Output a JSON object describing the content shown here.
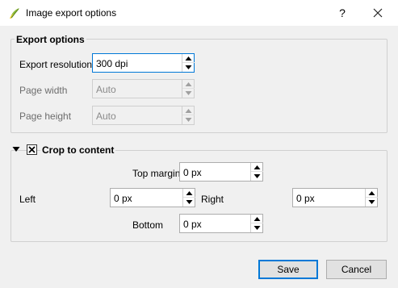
{
  "window": {
    "title": "Image export options",
    "help_label": "?",
    "app_icon": "qgis-icon",
    "close_icon": "close-icon"
  },
  "export_options": {
    "title": "Export options",
    "resolution": {
      "label": "Export resolution",
      "value": "300 dpi",
      "enabled": true
    },
    "page_width": {
      "label": "Page width",
      "value": "Auto",
      "enabled": false
    },
    "page_height": {
      "label": "Page height",
      "value": "Auto",
      "enabled": false
    }
  },
  "crop": {
    "title": "Crop to content",
    "checked": true,
    "expanded": true,
    "top_margin": {
      "label": "Top margin",
      "value": "0 px"
    },
    "left": {
      "label": "Left",
      "value": "0 px"
    },
    "right": {
      "label": "Right",
      "value": "0 px"
    },
    "bottom": {
      "label": "Bottom",
      "value": "0 px"
    }
  },
  "buttons": {
    "save": "Save",
    "cancel": "Cancel"
  },
  "colors": {
    "accent": "#0078d7",
    "qgis_green": "#8cbc3a",
    "qgis_yellow": "#f2d13c"
  }
}
